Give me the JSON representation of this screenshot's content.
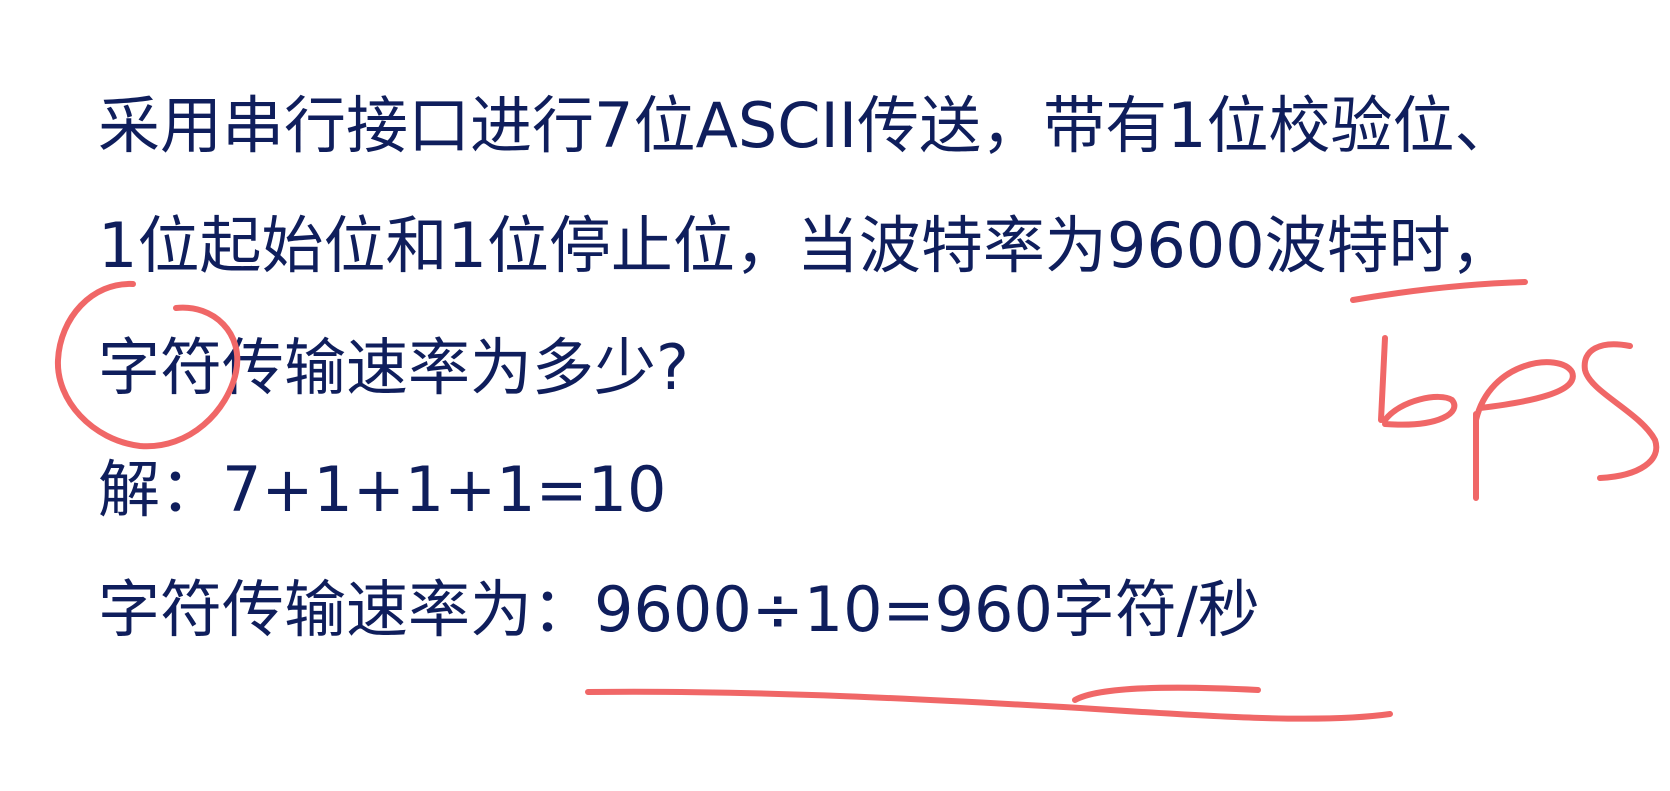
{
  "slide": {
    "lines": [
      "采用串行接口进行7位ASCII传送，带有1位校验位、",
      "1位起始位和1位停止位，当波特率为9600波特时，",
      "字符传输速率为多少?",
      "解：7+1+1+1=10",
      "字符传输速率为：9600÷10=960字符/秒"
    ]
  },
  "annotations": {
    "handwritten_note": "bps",
    "ink_color": "#f06767"
  },
  "colors": {
    "text": "#0f1e5c",
    "background": "#ffffff"
  }
}
